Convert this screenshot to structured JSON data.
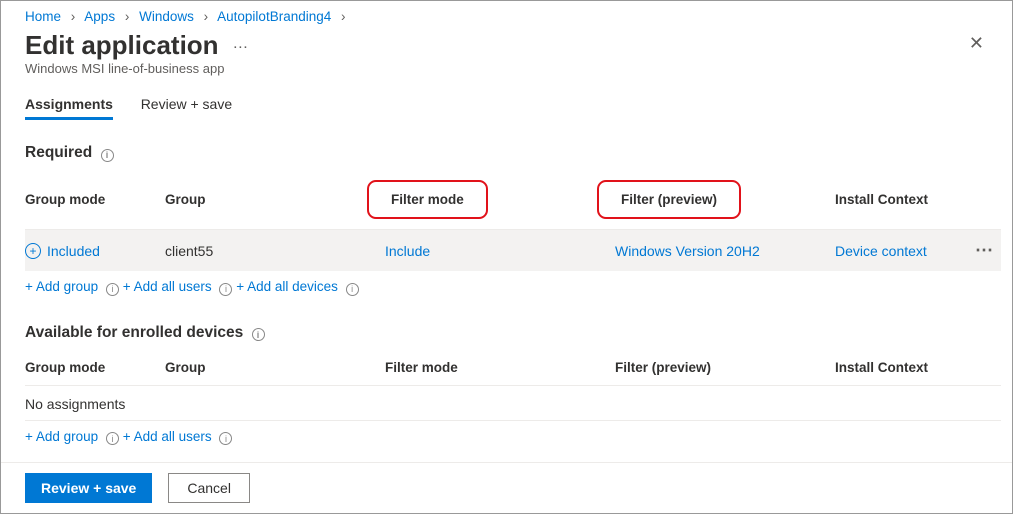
{
  "breadcrumbs": [
    "Home",
    "Apps",
    "Windows",
    "AutopilotBranding4"
  ],
  "header": {
    "title": "Edit application",
    "subtitle": "Windows MSI line-of-business app"
  },
  "tabs": {
    "assignments": "Assignments",
    "review_save": "Review + save"
  },
  "sections": {
    "required": {
      "title": "Required",
      "columns": {
        "group_mode": "Group mode",
        "group": "Group",
        "filter_mode": "Filter mode",
        "filter_preview": "Filter (preview)",
        "install_context": "Install Context"
      },
      "rows": [
        {
          "mode_label": "Included",
          "group": "client55",
          "filter_mode": "Include",
          "filter_preview": "Windows Version 20H2",
          "install_context": "Device context"
        }
      ],
      "actions": {
        "add_group": "+ Add group",
        "add_all_users": "+ Add all users",
        "add_all_devices": "+ Add all devices"
      }
    },
    "available": {
      "title": "Available for enrolled devices",
      "columns": {
        "group_mode": "Group mode",
        "group": "Group",
        "filter_mode": "Filter mode",
        "filter_preview": "Filter (preview)",
        "install_context": "Install Context"
      },
      "empty": "No assignments",
      "actions": {
        "add_group": "+ Add group",
        "add_all_users": "+ Add all users"
      }
    }
  },
  "footer": {
    "primary": "Review + save",
    "secondary": "Cancel"
  }
}
